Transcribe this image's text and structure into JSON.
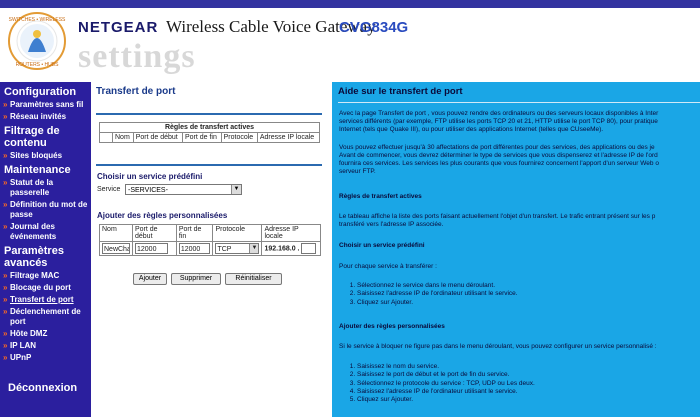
{
  "header": {
    "brand": "NETGEAR",
    "product": "Wireless Cable Voice Gateway",
    "model": "CVG834G",
    "settings_word": "settings"
  },
  "sidebar": {
    "sections": [
      {
        "title": "Configuration",
        "items": [
          "Paramètres sans fil",
          "Réseau invités"
        ]
      },
      {
        "title": "Filtrage de contenu",
        "items": [
          "Sites bloqués"
        ]
      },
      {
        "title": "Maintenance",
        "items": [
          "Statut de la passerelle",
          "Définition du mot de passe",
          "Journal des événements"
        ]
      },
      {
        "title": "Paramètres avancés",
        "items": [
          "Filtrage MAC",
          "Blocage du port",
          "Transfert de port",
          "Déclenchement de port",
          "Hôte DMZ",
          "IP LAN",
          "UPnP"
        ]
      }
    ],
    "logout": "Déconnexion"
  },
  "content": {
    "title": "Transfert de port",
    "rules_table": {
      "caption": "Règles de transfert actives",
      "headers": [
        "",
        "Nom",
        "Port de début",
        "Port de fin",
        "Protocole",
        "Adresse IP locale"
      ]
    },
    "predefined": {
      "heading": "Choisir un service prédéfini",
      "service_label": "Service",
      "service_value": "-SERVICES-"
    },
    "custom": {
      "heading": "Ajouter des règles personnalisées",
      "headers": [
        "Nom",
        "Port de début",
        "Port de fin",
        "Protocole",
        "Adresse IP locale"
      ],
      "name_value": "NewCha",
      "start_port": "12000",
      "end_port": "12000",
      "protocol": "TCP",
      "ip_prefix": "192.168.0 .",
      "ip_last": ""
    },
    "buttons": {
      "add": "Ajouter",
      "delete": "Supprimer",
      "reset": "Réinitialiser"
    }
  },
  "help": {
    "title": "Aide sur le transfert de port",
    "intro_lines": [
      "Avec la page Transfert de port , vous pouvez rendre des ordinateurs ou des serveurs locaux disponibles à Inter",
      "services différents (par exemple, FTP utilise les ports TCP 20 et 21, HTTP utilise le port TCP 80), pour pratique",
      "Internet (tels que Quake III), ou pour utiliser des applications Internet (telles que CUseeMe)."
    ],
    "para2_lines": [
      "Vous pouvez effectuer jusqu'à 30 affectations de port différentes pour des services, des applications ou des je",
      "Avant de commencer, vous devrez déterminer le type de services que vous dispenserez et l'adresse IP de l'ord",
      "fournira ces services. Les services les plus courants que vous fournirez concernent l'apport d'un serveur Web o",
      "serveur FTP."
    ],
    "s1_title": "Règles de transfert actives",
    "s1_lines": [
      "Le tableau affiche la liste des ports faisant actuellement l'objet d'un transfert. Le trafic entrant présent sur les p",
      "transféré vers l'adresse IP associée."
    ],
    "s2_title": "Choisir un service prédéfini",
    "s2_intro": "Pour chaque service à transférer :",
    "s2_steps": [
      "Sélectionnez le service dans le menu déroulant.",
      "Saisissez l'adresse IP de l'ordinateur utilisant le service.",
      "Cliquez sur Ajouter."
    ],
    "s3_title": "Ajouter des règles personnalisées",
    "s3_intro": "Si le service à bloquer ne figure pas dans le menu déroulant, vous pouvez configurer un service personnalisé :",
    "s3_steps": [
      "Saisissez le nom du service.",
      "Saisissez le port de début et le port de fin du service.",
      "Sélectionnez le protocole du service : TCP, UDP ou Les deux.",
      "Saisissez l'adresse IP de l'ordinateur utilisant le service.",
      "Cliquez sur Ajouter."
    ]
  }
}
